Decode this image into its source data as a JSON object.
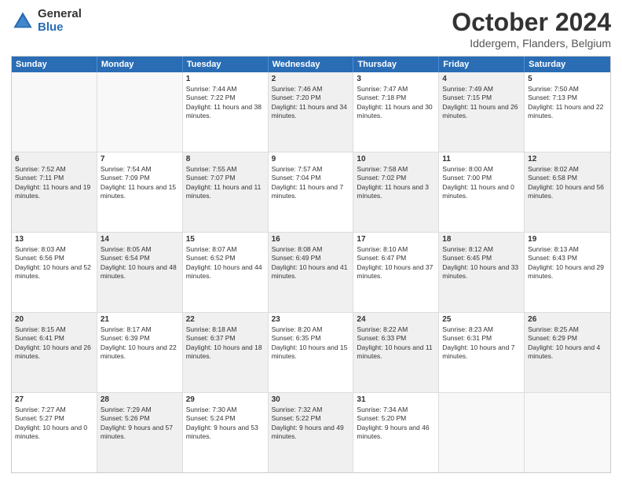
{
  "logo": {
    "general": "General",
    "blue": "Blue"
  },
  "header": {
    "title": "October 2024",
    "subtitle": "Iddergem, Flanders, Belgium"
  },
  "weekdays": [
    "Sunday",
    "Monday",
    "Tuesday",
    "Wednesday",
    "Thursday",
    "Friday",
    "Saturday"
  ],
  "rows": [
    [
      {
        "day": "",
        "sunrise": "",
        "sunset": "",
        "daylight": "",
        "shaded": false,
        "empty": true
      },
      {
        "day": "",
        "sunrise": "",
        "sunset": "",
        "daylight": "",
        "shaded": false,
        "empty": true
      },
      {
        "day": "1",
        "sunrise": "Sunrise: 7:44 AM",
        "sunset": "Sunset: 7:22 PM",
        "daylight": "Daylight: 11 hours and 38 minutes.",
        "shaded": false,
        "empty": false
      },
      {
        "day": "2",
        "sunrise": "Sunrise: 7:46 AM",
        "sunset": "Sunset: 7:20 PM",
        "daylight": "Daylight: 11 hours and 34 minutes.",
        "shaded": true,
        "empty": false
      },
      {
        "day": "3",
        "sunrise": "Sunrise: 7:47 AM",
        "sunset": "Sunset: 7:18 PM",
        "daylight": "Daylight: 11 hours and 30 minutes.",
        "shaded": false,
        "empty": false
      },
      {
        "day": "4",
        "sunrise": "Sunrise: 7:49 AM",
        "sunset": "Sunset: 7:15 PM",
        "daylight": "Daylight: 11 hours and 26 minutes.",
        "shaded": true,
        "empty": false
      },
      {
        "day": "5",
        "sunrise": "Sunrise: 7:50 AM",
        "sunset": "Sunset: 7:13 PM",
        "daylight": "Daylight: 11 hours and 22 minutes.",
        "shaded": false,
        "empty": false
      }
    ],
    [
      {
        "day": "6",
        "sunrise": "Sunrise: 7:52 AM",
        "sunset": "Sunset: 7:11 PM",
        "daylight": "Daylight: 11 hours and 19 minutes.",
        "shaded": true,
        "empty": false
      },
      {
        "day": "7",
        "sunrise": "Sunrise: 7:54 AM",
        "sunset": "Sunset: 7:09 PM",
        "daylight": "Daylight: 11 hours and 15 minutes.",
        "shaded": false,
        "empty": false
      },
      {
        "day": "8",
        "sunrise": "Sunrise: 7:55 AM",
        "sunset": "Sunset: 7:07 PM",
        "daylight": "Daylight: 11 hours and 11 minutes.",
        "shaded": true,
        "empty": false
      },
      {
        "day": "9",
        "sunrise": "Sunrise: 7:57 AM",
        "sunset": "Sunset: 7:04 PM",
        "daylight": "Daylight: 11 hours and 7 minutes.",
        "shaded": false,
        "empty": false
      },
      {
        "day": "10",
        "sunrise": "Sunrise: 7:58 AM",
        "sunset": "Sunset: 7:02 PM",
        "daylight": "Daylight: 11 hours and 3 minutes.",
        "shaded": true,
        "empty": false
      },
      {
        "day": "11",
        "sunrise": "Sunrise: 8:00 AM",
        "sunset": "Sunset: 7:00 PM",
        "daylight": "Daylight: 11 hours and 0 minutes.",
        "shaded": false,
        "empty": false
      },
      {
        "day": "12",
        "sunrise": "Sunrise: 8:02 AM",
        "sunset": "Sunset: 6:58 PM",
        "daylight": "Daylight: 10 hours and 56 minutes.",
        "shaded": true,
        "empty": false
      }
    ],
    [
      {
        "day": "13",
        "sunrise": "Sunrise: 8:03 AM",
        "sunset": "Sunset: 6:56 PM",
        "daylight": "Daylight: 10 hours and 52 minutes.",
        "shaded": false,
        "empty": false
      },
      {
        "day": "14",
        "sunrise": "Sunrise: 8:05 AM",
        "sunset": "Sunset: 6:54 PM",
        "daylight": "Daylight: 10 hours and 48 minutes.",
        "shaded": true,
        "empty": false
      },
      {
        "day": "15",
        "sunrise": "Sunrise: 8:07 AM",
        "sunset": "Sunset: 6:52 PM",
        "daylight": "Daylight: 10 hours and 44 minutes.",
        "shaded": false,
        "empty": false
      },
      {
        "day": "16",
        "sunrise": "Sunrise: 8:08 AM",
        "sunset": "Sunset: 6:49 PM",
        "daylight": "Daylight: 10 hours and 41 minutes.",
        "shaded": true,
        "empty": false
      },
      {
        "day": "17",
        "sunrise": "Sunrise: 8:10 AM",
        "sunset": "Sunset: 6:47 PM",
        "daylight": "Daylight: 10 hours and 37 minutes.",
        "shaded": false,
        "empty": false
      },
      {
        "day": "18",
        "sunrise": "Sunrise: 8:12 AM",
        "sunset": "Sunset: 6:45 PM",
        "daylight": "Daylight: 10 hours and 33 minutes.",
        "shaded": true,
        "empty": false
      },
      {
        "day": "19",
        "sunrise": "Sunrise: 8:13 AM",
        "sunset": "Sunset: 6:43 PM",
        "daylight": "Daylight: 10 hours and 29 minutes.",
        "shaded": false,
        "empty": false
      }
    ],
    [
      {
        "day": "20",
        "sunrise": "Sunrise: 8:15 AM",
        "sunset": "Sunset: 6:41 PM",
        "daylight": "Daylight: 10 hours and 26 minutes.",
        "shaded": true,
        "empty": false
      },
      {
        "day": "21",
        "sunrise": "Sunrise: 8:17 AM",
        "sunset": "Sunset: 6:39 PM",
        "daylight": "Daylight: 10 hours and 22 minutes.",
        "shaded": false,
        "empty": false
      },
      {
        "day": "22",
        "sunrise": "Sunrise: 8:18 AM",
        "sunset": "Sunset: 6:37 PM",
        "daylight": "Daylight: 10 hours and 18 minutes.",
        "shaded": true,
        "empty": false
      },
      {
        "day": "23",
        "sunrise": "Sunrise: 8:20 AM",
        "sunset": "Sunset: 6:35 PM",
        "daylight": "Daylight: 10 hours and 15 minutes.",
        "shaded": false,
        "empty": false
      },
      {
        "day": "24",
        "sunrise": "Sunrise: 8:22 AM",
        "sunset": "Sunset: 6:33 PM",
        "daylight": "Daylight: 10 hours and 11 minutes.",
        "shaded": true,
        "empty": false
      },
      {
        "day": "25",
        "sunrise": "Sunrise: 8:23 AM",
        "sunset": "Sunset: 6:31 PM",
        "daylight": "Daylight: 10 hours and 7 minutes.",
        "shaded": false,
        "empty": false
      },
      {
        "day": "26",
        "sunrise": "Sunrise: 8:25 AM",
        "sunset": "Sunset: 6:29 PM",
        "daylight": "Daylight: 10 hours and 4 minutes.",
        "shaded": true,
        "empty": false
      }
    ],
    [
      {
        "day": "27",
        "sunrise": "Sunrise: 7:27 AM",
        "sunset": "Sunset: 5:27 PM",
        "daylight": "Daylight: 10 hours and 0 minutes.",
        "shaded": false,
        "empty": false
      },
      {
        "day": "28",
        "sunrise": "Sunrise: 7:29 AM",
        "sunset": "Sunset: 5:26 PM",
        "daylight": "Daylight: 9 hours and 57 minutes.",
        "shaded": true,
        "empty": false
      },
      {
        "day": "29",
        "sunrise": "Sunrise: 7:30 AM",
        "sunset": "Sunset: 5:24 PM",
        "daylight": "Daylight: 9 hours and 53 minutes.",
        "shaded": false,
        "empty": false
      },
      {
        "day": "30",
        "sunrise": "Sunrise: 7:32 AM",
        "sunset": "Sunset: 5:22 PM",
        "daylight": "Daylight: 9 hours and 49 minutes.",
        "shaded": true,
        "empty": false
      },
      {
        "day": "31",
        "sunrise": "Sunrise: 7:34 AM",
        "sunset": "Sunset: 5:20 PM",
        "daylight": "Daylight: 9 hours and 46 minutes.",
        "shaded": false,
        "empty": false
      },
      {
        "day": "",
        "sunrise": "",
        "sunset": "",
        "daylight": "",
        "shaded": true,
        "empty": true
      },
      {
        "day": "",
        "sunrise": "",
        "sunset": "",
        "daylight": "",
        "shaded": false,
        "empty": true
      }
    ]
  ]
}
